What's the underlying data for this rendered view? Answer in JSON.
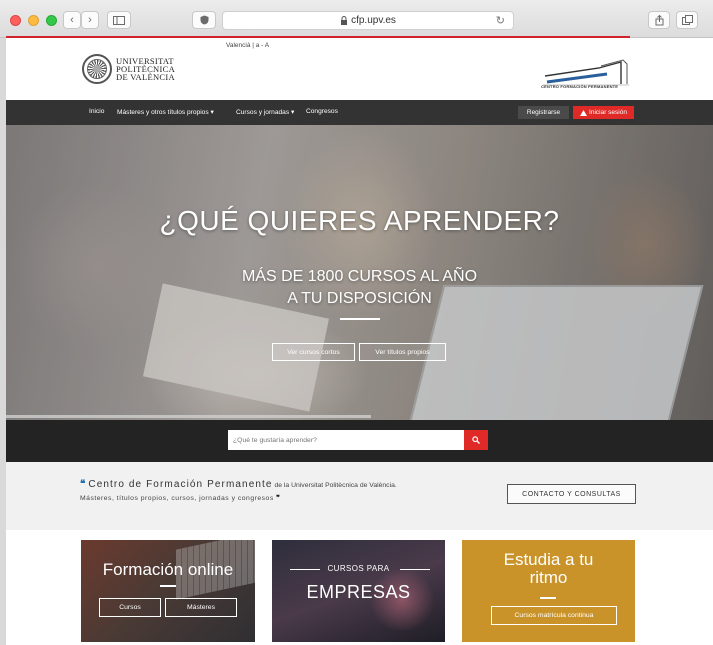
{
  "browser": {
    "url": "cfp.upv.es",
    "nav_back": "‹",
    "nav_forward": "›",
    "reload": "↻",
    "colors": {
      "progress": "#d3232a"
    }
  },
  "header": {
    "lang_switch": "Valencià  |    a - A",
    "upv_logo": {
      "line1": "UNIVERSITAT",
      "line2": "POLITÈCNICA",
      "line3": "DE VALÈNCIA"
    },
    "cfp_logo_caption": "CENTRO FORMACIÓN PERMANENTE"
  },
  "nav": {
    "items": [
      {
        "label": "Inicio"
      },
      {
        "label": "Másteres y otros títulos propios ▾"
      },
      {
        "label": "Cursos y jornadas ▾"
      },
      {
        "label": "Congresos"
      }
    ],
    "register_label": "Registrarse",
    "login_label": "Iniciar sesión"
  },
  "hero": {
    "title": "¿QUÉ QUIERES APRENDER?",
    "subtitle_line1": "MÁS DE 1800 CURSOS AL AÑO",
    "subtitle_line2": "A TU DISPOSICIÓN",
    "btn_short": "Ver cursos cortos",
    "btn_titles": "Ver títulos propios"
  },
  "search": {
    "placeholder": "¿Qué te gustaría aprender?"
  },
  "intro": {
    "open_quote": "❝",
    "name": "Centro de Formación Permanente",
    "rest_line1": " de la Universitat Politècnica de València.",
    "line2": "Másteres, títulos propios, cursos, jornadas y congresos",
    "close_quote": "❞",
    "contact_label": "CONTACTO Y CONSULTAS"
  },
  "cards": {
    "online": {
      "title": "Formación online",
      "btn_courses": "Cursos",
      "btn_masters": "Másteres"
    },
    "business": {
      "small": "CURSOS PARA",
      "big": "EMPRESAS"
    },
    "own_pace": {
      "title_line1": "Estudia a tu",
      "title_line2": "ritmo",
      "btn": "Cursos matrícula continua"
    }
  }
}
